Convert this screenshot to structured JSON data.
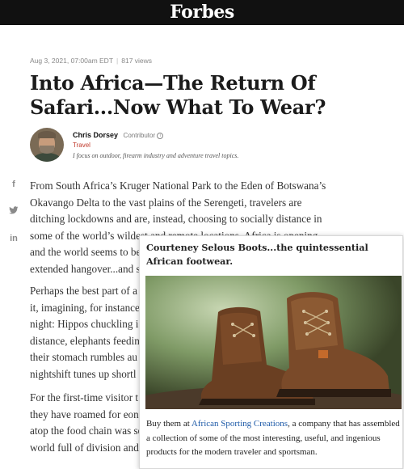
{
  "header": {
    "logo": "Forbes"
  },
  "article": {
    "date": "Aug 3, 2021, 07:00am EDT",
    "views": "817 views",
    "headline_line1": "Into Africa—The Return Of",
    "headline_line2": "Safari...Now What To Wear?",
    "author_name": "Chris Dorsey",
    "author_role": "Contributor",
    "channel": "Travel",
    "bio": "I focus on outdoor, firearm industry and adventure travel topics.",
    "paragraphs": [
      [
        "From South Africa’s Kruger National Park to the Eden of Botswana’s",
        "Okavango Delta to the vast plains of the Serengeti, travelers are",
        "ditching lockdowns and are, instead, choosing to socially distance in",
        "some of the world’s wildest and remote locations. Africa is opening",
        "and the world seems to be",
        "extended hangover...and s"
      ],
      [
        "Perhaps the best part of a",
        "it, imagining, for instance",
        "night: Hippos chuckling i",
        "distance, elephants feedin",
        "their stomach rumbles au",
        "nightshift tunes up shortl"
      ],
      [
        "For the first-time visitor t",
        "they have roamed for eons",
        "atop the food chain was se",
        "world full of division and"
      ]
    ]
  },
  "share": {
    "facebook": "f",
    "twitter": "•",
    "linkedin": "in"
  },
  "popup": {
    "caption": "Courteney Selous Boots...the quintessential African footwear.",
    "buy_prefix": "Buy them at ",
    "link_text": "African Sporting Creations",
    "buy_suffix": ", a company that has assembled a collection of some of the most interesting, useful, and ingenious products for the modern traveler and sportsman."
  }
}
